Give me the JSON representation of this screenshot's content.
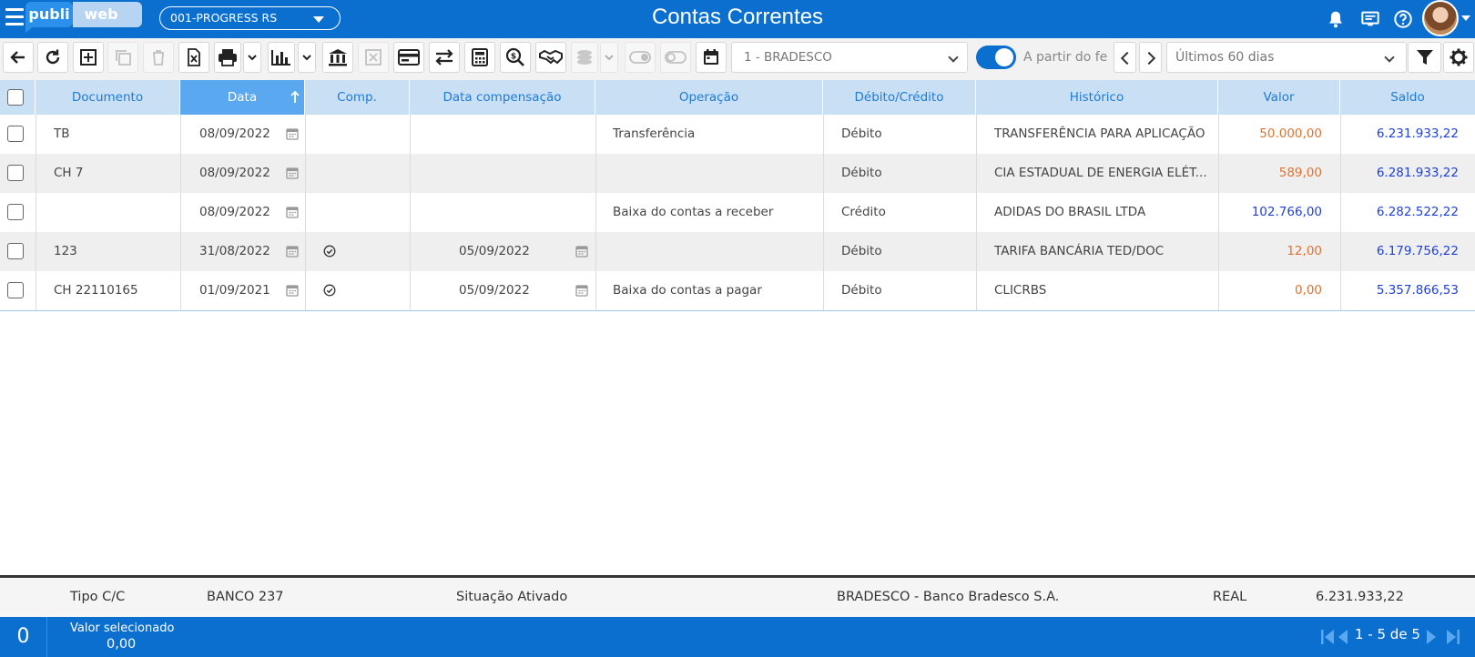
{
  "header": {
    "title": "Contas Correntes",
    "logo_left": "publi",
    "logo_right": "web",
    "company": "001-PROGRESS RS"
  },
  "toolbar": {
    "bank_account": "1 - BRADESCO",
    "from_date_label": "A partir do fe",
    "period": "Últimos 60 dias"
  },
  "table": {
    "columns": [
      "Documento",
      "Data",
      "Comp.",
      "Data compensação",
      "Operação",
      "Débito/Crédito",
      "Histórico",
      "Valor",
      "Saldo"
    ],
    "rows": [
      {
        "documento": "TB",
        "data": "08/09/2022",
        "comp": false,
        "data_comp": "",
        "operacao": "Transferência",
        "deb_cred": "Débito",
        "historico": "TRANSFERÊNCIA PARA APLICAÇÃO",
        "valor": "50.000,00",
        "saldo": "6.231.933,22"
      },
      {
        "documento": "CH 7",
        "data": "08/09/2022",
        "comp": false,
        "data_comp": "",
        "operacao": "",
        "deb_cred": "Débito",
        "historico": "CIA ESTADUAL DE ENERGIA ELÉT...",
        "valor": "589,00",
        "saldo": "6.281.933,22"
      },
      {
        "documento": "",
        "data": "08/09/2022",
        "comp": false,
        "data_comp": "",
        "operacao": "Baixa do contas a receber",
        "deb_cred": "Crédito",
        "historico": "ADIDAS DO BRASIL LTDA",
        "valor": "102.766,00",
        "saldo": "6.282.522,22"
      },
      {
        "documento": "123",
        "data": "31/08/2022",
        "comp": true,
        "data_comp": "05/09/2022",
        "operacao": "",
        "deb_cred": "Débito",
        "historico": "TARIFA BANCÁRIA TED/DOC",
        "valor": "12,00",
        "saldo": "6.179.756,22"
      },
      {
        "documento": "CH 22110165",
        "data": "01/09/2021",
        "comp": true,
        "data_comp": "05/09/2022",
        "operacao": "Baixa do contas a pagar",
        "deb_cred": "Débito",
        "historico": "CLICRBS",
        "valor": "0,00",
        "saldo": "5.357.866,53"
      }
    ]
  },
  "summary": {
    "tipo": "Tipo C/C",
    "banco": "BANCO 237",
    "situacao": "Situação Ativado",
    "banco_nome": "BRADESCO - Banco Bradesco S.A.",
    "moeda": "REAL",
    "saldo": "6.231.933,22"
  },
  "status": {
    "selected_count": "0",
    "selected_label": "Valor selecionado",
    "selected_value": "0,00",
    "pagination": "1 - 5 de 5"
  },
  "colors": {
    "primary": "#0a6fcf",
    "debit": "#e2722d",
    "credit": "#1f40d8"
  }
}
